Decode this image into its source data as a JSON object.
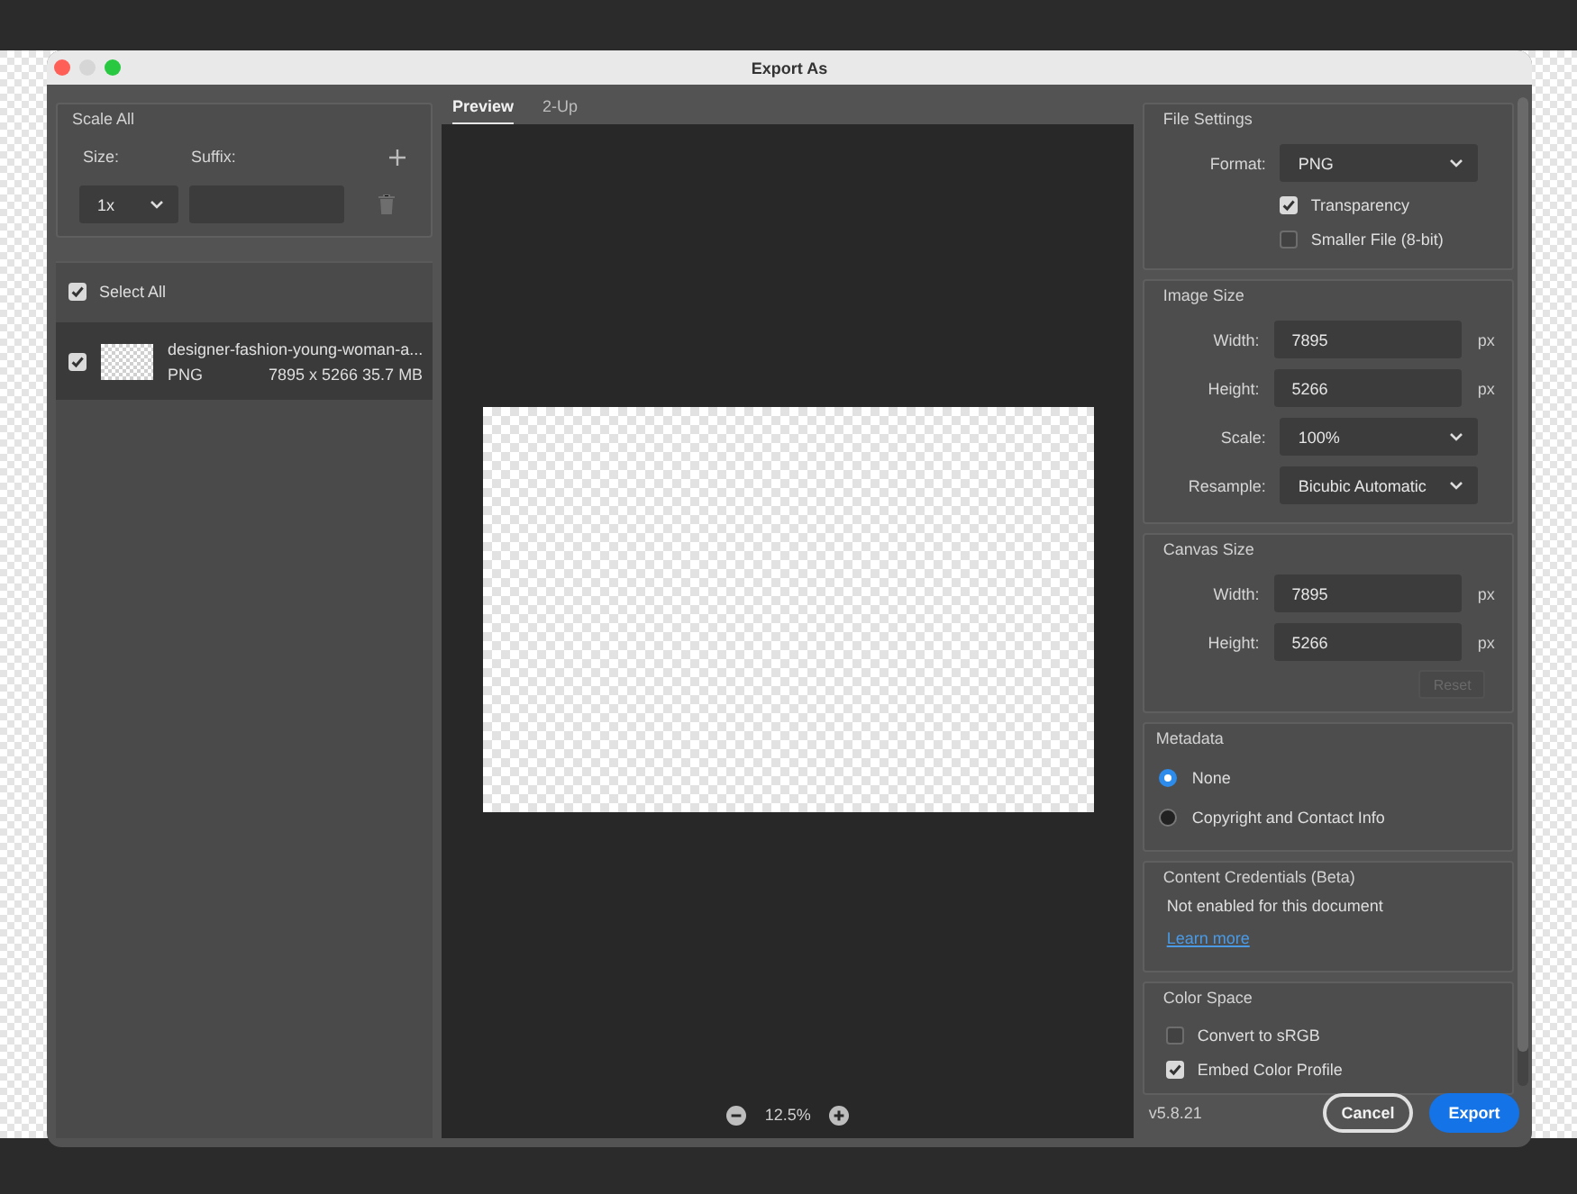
{
  "window": {
    "title": "Export As"
  },
  "scale_all": {
    "title": "Scale All",
    "size_label": "Size:",
    "suffix_label": "Suffix:",
    "size": "1x"
  },
  "select_all": {
    "label": "Select All",
    "checked": true
  },
  "assets": [
    {
      "name": "designer-fashion-young-woman-a...",
      "format": "PNG",
      "dimensions": "7895 x 5266",
      "file_size": "35.7 MB",
      "checked": true,
      "selected": true
    }
  ],
  "preview_tabs": [
    {
      "label": "Preview",
      "selected": true
    },
    {
      "label": "2-Up",
      "selected": false
    }
  ],
  "zoom": "12.5%",
  "file_settings": {
    "title": "File Settings",
    "format_label": "Format:",
    "format": "PNG",
    "options": [
      {
        "label": "Transparency",
        "checked": true
      },
      {
        "label": "Smaller File (8-bit)",
        "checked": false
      }
    ]
  },
  "image_size": {
    "title": "Image Size",
    "fields": [
      {
        "kind": "input",
        "label": "Width:",
        "value": "7895",
        "unit": "px"
      },
      {
        "kind": "input",
        "label": "Height:",
        "value": "5266",
        "unit": "px"
      },
      {
        "kind": "select",
        "label": "Scale:",
        "value": "100%"
      },
      {
        "kind": "select",
        "label": "Resample:",
        "value": "Bicubic Automatic"
      }
    ]
  },
  "canvas_size": {
    "title": "Canvas Size",
    "fields": [
      {
        "kind": "input",
        "label": "Width:",
        "value": "7895",
        "unit": "px"
      },
      {
        "kind": "input",
        "label": "Height:",
        "value": "5266",
        "unit": "px"
      }
    ],
    "reset": {
      "label": "Reset",
      "disabled": true
    }
  },
  "metadata": {
    "title": "Metadata",
    "options": [
      {
        "label": "None",
        "selected": true
      },
      {
        "label": "Copyright and Contact Info",
        "selected": false
      }
    ]
  },
  "content_credentials": {
    "title": "Content Credentials (Beta)",
    "text": "Not enabled for this document",
    "link": "Learn more"
  },
  "color_space": {
    "title": "Color Space",
    "options": [
      {
        "label": "Convert to sRGB",
        "checked": false
      },
      {
        "label": "Embed Color Profile",
        "checked": true
      }
    ]
  },
  "version": "v5.8.21",
  "buttons": [
    {
      "kind": "secondary",
      "label": "Cancel"
    },
    {
      "kind": "primary",
      "label": "Export"
    }
  ]
}
